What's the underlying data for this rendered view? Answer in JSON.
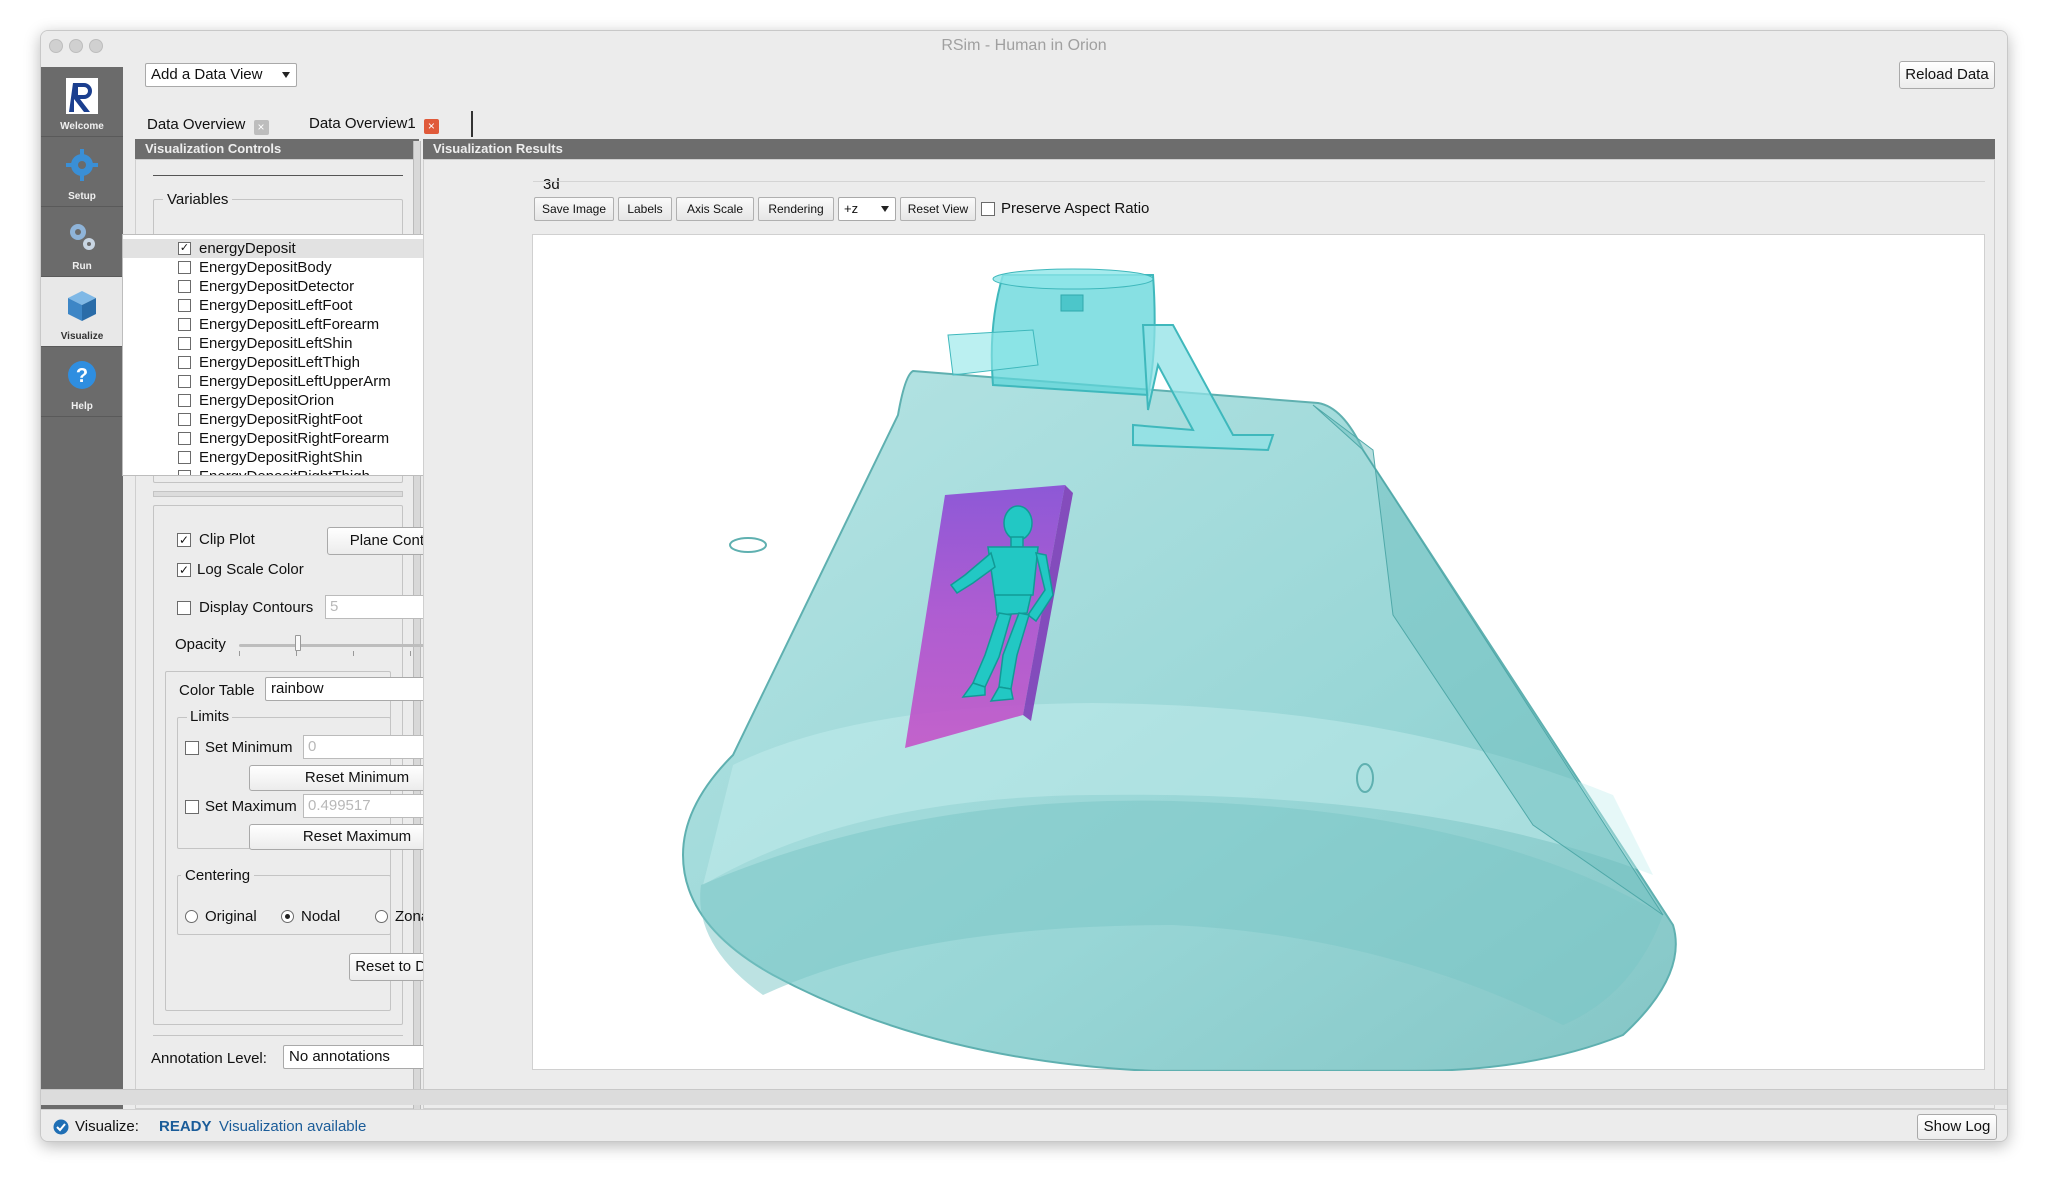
{
  "window": {
    "title": "RSim - Human in Orion"
  },
  "sidebar": {
    "items": [
      {
        "label": "Welcome",
        "icon": "rsim-logo-icon"
      },
      {
        "label": "Setup",
        "icon": "gear-icon"
      },
      {
        "label": "Run",
        "icon": "gears-icon"
      },
      {
        "label": "Visualize",
        "icon": "cube-icon"
      },
      {
        "label": "Help",
        "icon": "help-icon"
      }
    ],
    "active": "Visualize"
  },
  "toolbar": {
    "add_view": "Add a Data View",
    "reload": "Reload Data"
  },
  "tabs": [
    {
      "label": "Data Overview",
      "close": "×"
    },
    {
      "label": "Data Overview1",
      "close": "×"
    }
  ],
  "controls": {
    "header": "Visualization Controls",
    "variables_title": "Variables",
    "variables": [
      {
        "name": "energyDeposit",
        "checked": true
      },
      {
        "name": "EnergyDepositBody",
        "checked": false
      },
      {
        "name": "EnergyDepositDetector",
        "checked": false
      },
      {
        "name": "EnergyDepositLeftFoot",
        "checked": false
      },
      {
        "name": "EnergyDepositLeftForearm",
        "checked": false
      },
      {
        "name": "EnergyDepositLeftShin",
        "checked": false
      },
      {
        "name": "EnergyDepositLeftThigh",
        "checked": false
      },
      {
        "name": "EnergyDepositLeftUpperArm",
        "checked": false
      },
      {
        "name": "EnergyDepositOrion",
        "checked": false
      },
      {
        "name": "EnergyDepositRightFoot",
        "checked": false
      },
      {
        "name": "EnergyDepositRightForearm",
        "checked": false
      },
      {
        "name": "EnergyDepositRightShin",
        "checked": false
      },
      {
        "name": "EnergyDepositRightThigh",
        "checked": false
      }
    ],
    "clip_plot": "Clip Plot",
    "clip_plot_checked": true,
    "plane_controls": "Plane Controls",
    "log_scale": "Log Scale Color",
    "log_scale_checked": true,
    "display_contours": "Display Contours",
    "display_contours_checked": false,
    "contours_value": "5",
    "opacity": "Opacity",
    "color_table_label": "Color Table",
    "color_table": "rainbow",
    "limits_title": "Limits",
    "set_min": "Set Minimum",
    "min_value": "0",
    "reset_min": "Reset Minimum",
    "set_max": "Set Maximum",
    "max_value": "0.499517",
    "reset_max": "Reset Maximum",
    "centering_title": "Centering",
    "centering": [
      "Original",
      "Nodal",
      "Zonal"
    ],
    "centering_selected": "Nodal",
    "reset_default": "Reset to Default",
    "annotation_label": "Annotation Level:",
    "annotation_value": "No annotations"
  },
  "results": {
    "header": "Visualization Results",
    "view_label": "3d",
    "buttons": [
      "Save Image",
      "Labels",
      "Axis Scale",
      "Rendering"
    ],
    "axis_select": "+z",
    "reset_view": "Reset View",
    "preserve_aspect": "Preserve Aspect Ratio"
  },
  "status": {
    "label": "Visualize:",
    "state": "READY",
    "message": "Visualization available",
    "show_log": "Show Log"
  },
  "colors": {
    "capsule": "#8fd3d3",
    "capsule_edge": "#5fb9b9",
    "tower": "#6ad8dc",
    "detector": "#b24fd0",
    "body": "#28c9c4",
    "status_ready": "#1a5c99"
  }
}
